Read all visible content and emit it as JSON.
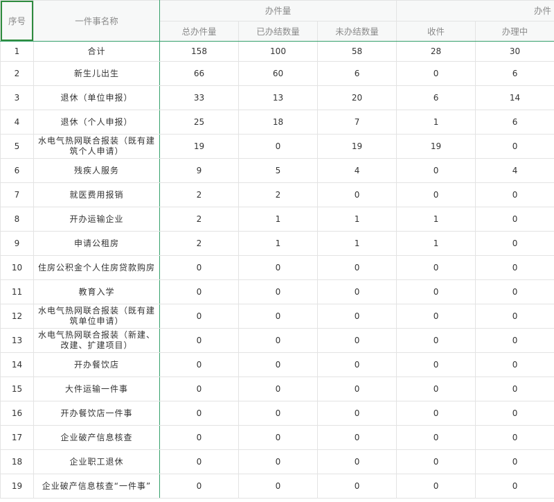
{
  "table": {
    "header": {
      "seq": "序号",
      "name": "一件事名称",
      "group1": "办件量",
      "group2": "办件",
      "sub": [
        "总办件量",
        "已办结数量",
        "未办结数量",
        "收件",
        "办理中"
      ]
    },
    "rows": [
      {
        "no": "1",
        "name": "合计",
        "v": [
          "158",
          "100",
          "58",
          "28",
          "30"
        ]
      },
      {
        "no": "2",
        "name": "新生儿出生",
        "v": [
          "66",
          "60",
          "6",
          "0",
          "6"
        ]
      },
      {
        "no": "3",
        "name": "退休（单位申报）",
        "v": [
          "33",
          "13",
          "20",
          "6",
          "14"
        ]
      },
      {
        "no": "4",
        "name": "退休（个人申报）",
        "v": [
          "25",
          "18",
          "7",
          "1",
          "6"
        ]
      },
      {
        "no": "5",
        "name": "水电气热网联合报装（既有建筑个人申请）",
        "v": [
          "19",
          "0",
          "19",
          "19",
          "0"
        ]
      },
      {
        "no": "6",
        "name": "残疾人服务",
        "v": [
          "9",
          "5",
          "4",
          "0",
          "4"
        ]
      },
      {
        "no": "7",
        "name": "就医费用报销",
        "v": [
          "2",
          "2",
          "0",
          "0",
          "0"
        ]
      },
      {
        "no": "8",
        "name": "开办运输企业",
        "v": [
          "2",
          "1",
          "1",
          "1",
          "0"
        ]
      },
      {
        "no": "9",
        "name": "申请公租房",
        "v": [
          "2",
          "1",
          "1",
          "1",
          "0"
        ]
      },
      {
        "no": "10",
        "name": "住房公积金个人住房贷款购房",
        "v": [
          "0",
          "0",
          "0",
          "0",
          "0"
        ]
      },
      {
        "no": "11",
        "name": "教育入学",
        "v": [
          "0",
          "0",
          "0",
          "0",
          "0"
        ]
      },
      {
        "no": "12",
        "name": "水电气热网联合报装（既有建筑单位申请）",
        "v": [
          "0",
          "0",
          "0",
          "0",
          "0"
        ]
      },
      {
        "no": "13",
        "name": "水电气热网联合报装（新建、改建、扩建项目）",
        "v": [
          "0",
          "0",
          "0",
          "0",
          "0"
        ]
      },
      {
        "no": "14",
        "name": "开办餐饮店",
        "v": [
          "0",
          "0",
          "0",
          "0",
          "0"
        ]
      },
      {
        "no": "15",
        "name": "大件运输一件事",
        "v": [
          "0",
          "0",
          "0",
          "0",
          "0"
        ]
      },
      {
        "no": "16",
        "name": "开办餐饮店一件事",
        "v": [
          "0",
          "0",
          "0",
          "0",
          "0"
        ]
      },
      {
        "no": "17",
        "name": "企业破产信息核查",
        "v": [
          "0",
          "0",
          "0",
          "0",
          "0"
        ]
      },
      {
        "no": "18",
        "name": "企业职工退休",
        "v": [
          "0",
          "0",
          "0",
          "0",
          "0"
        ]
      },
      {
        "no": "19",
        "name": "企业破产信息核查“一件事”",
        "v": [
          "0",
          "0",
          "0",
          "0",
          "0"
        ]
      }
    ]
  },
  "colors": {
    "accent_green": "#35a06a",
    "selection_green": "#2e8b3e",
    "header_bg": "#f7f8f8",
    "grid": "#e3e3e3"
  }
}
